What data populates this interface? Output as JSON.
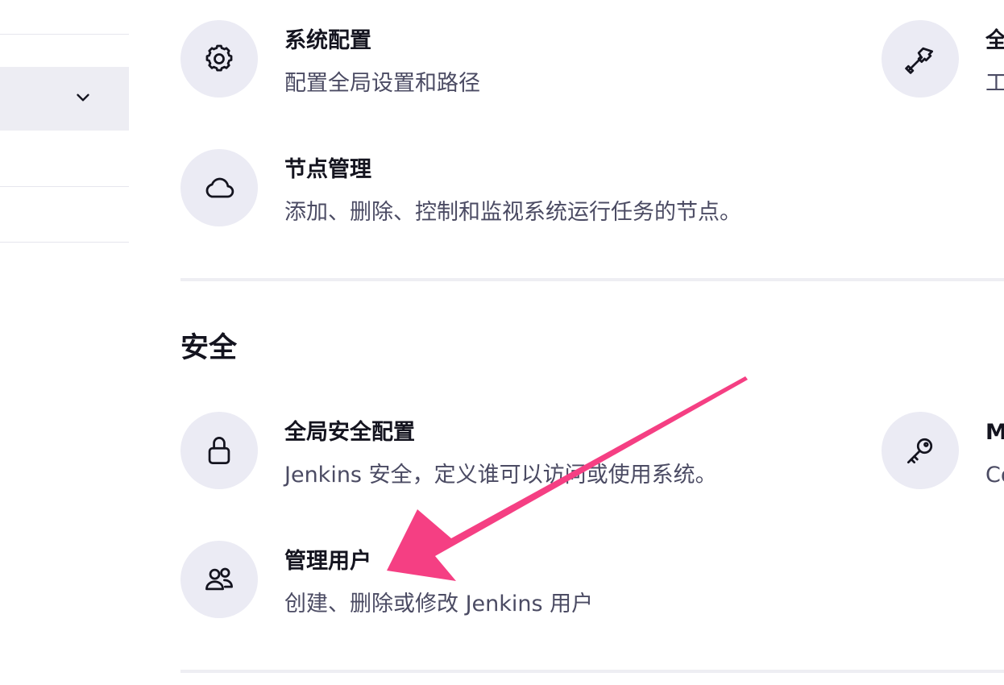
{
  "system_config": {
    "title": "系统配置",
    "desc": "配置全局设置和路径"
  },
  "global_tools": {
    "title": "全",
    "desc": "工"
  },
  "node_manage": {
    "title": "节点管理",
    "desc": "添加、删除、控制和监视系统运行任务的节点。"
  },
  "security": {
    "section_title": "安全",
    "global_security": {
      "title": "全局安全配置",
      "desc": "Jenkins 安全，定义谁可以访问或使用系统。"
    },
    "manage_credentials": {
      "title": "M",
      "desc": "Co"
    },
    "manage_users": {
      "title": "管理用户",
      "desc": "创建、删除或修改 Jenkins 用户"
    }
  },
  "icons": {
    "system_config": "gear-icon",
    "global_tools": "hammer-icon",
    "node_manage": "cloud-icon",
    "global_security": "lock-icon",
    "manage_credentials": "key-icon",
    "manage_users": "users-icon",
    "sidebar_expand": "chevron-down-icon"
  },
  "colors": {
    "icon_bg": "#ebebf4",
    "annotation_arrow": "#f53f83",
    "desc_text": "#4b4b63"
  }
}
